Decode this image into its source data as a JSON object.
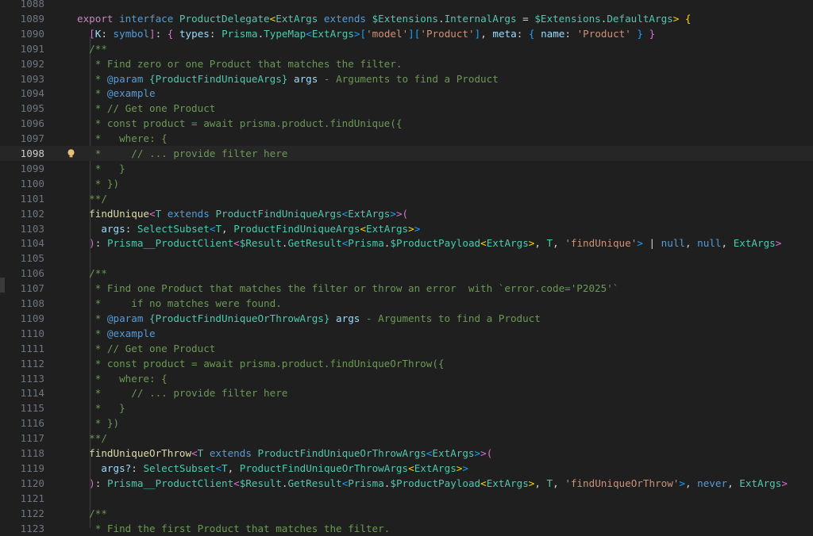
{
  "editor": {
    "current_line": 1098,
    "lines": [
      {
        "n": "1088",
        "tokens": []
      },
      {
        "n": "1089",
        "tokens": [
          [
            "kw2",
            "export "
          ],
          [
            "kw",
            "interface "
          ],
          [
            "ty",
            "ProductDelegate"
          ],
          [
            "br1",
            "<"
          ],
          [
            "ty",
            "ExtArgs "
          ],
          [
            "kw",
            "extends "
          ],
          [
            "ty",
            "$Extensions"
          ],
          [
            "pn",
            "."
          ],
          [
            "ty",
            "InternalArgs"
          ],
          [
            "pn",
            " = "
          ],
          [
            "ty",
            "$Extensions"
          ],
          [
            "pn",
            "."
          ],
          [
            "ty",
            "DefaultArgs"
          ],
          [
            "br1",
            "> "
          ],
          [
            "br1",
            "{"
          ]
        ]
      },
      {
        "n": "1090",
        "tokens": [
          [
            "pn",
            "  "
          ],
          [
            "br2",
            "["
          ],
          [
            "id",
            "K"
          ],
          [
            "pn",
            ": "
          ],
          [
            "kw",
            "symbol"
          ],
          [
            "br2",
            "]"
          ],
          [
            "pn",
            ": "
          ],
          [
            "br2",
            "{ "
          ],
          [
            "id",
            "types"
          ],
          [
            "pn",
            ": "
          ],
          [
            "ty",
            "Prisma"
          ],
          [
            "pn",
            "."
          ],
          [
            "ty",
            "TypeMap"
          ],
          [
            "br3",
            "<"
          ],
          [
            "ty",
            "ExtArgs"
          ],
          [
            "br3",
            ">"
          ],
          [
            "br3",
            "["
          ],
          [
            "str",
            "'model'"
          ],
          [
            "br3",
            "]"
          ],
          [
            "br3",
            "["
          ],
          [
            "str",
            "'Product'"
          ],
          [
            "br3",
            "]"
          ],
          [
            "pn",
            ", "
          ],
          [
            "id",
            "meta"
          ],
          [
            "pn",
            ": "
          ],
          [
            "br3",
            "{ "
          ],
          [
            "id",
            "name"
          ],
          [
            "pn",
            ": "
          ],
          [
            "str",
            "'Product'"
          ],
          [
            "br3",
            " }"
          ],
          [
            "br2",
            " }"
          ]
        ]
      },
      {
        "n": "1091",
        "tokens": [
          [
            "cm",
            "  /**"
          ]
        ]
      },
      {
        "n": "1092",
        "tokens": [
          [
            "cm",
            "   * Find zero or one Product that matches the filter."
          ]
        ]
      },
      {
        "n": "1093",
        "tokens": [
          [
            "cm",
            "   * "
          ],
          [
            "jd",
            "@param "
          ],
          [
            "jt",
            "{ProductFindUniqueArgs} "
          ],
          [
            "id",
            "args "
          ],
          [
            "cm",
            "- Arguments to find a Product"
          ]
        ]
      },
      {
        "n": "1094",
        "tokens": [
          [
            "cm",
            "   * "
          ],
          [
            "jd",
            "@example"
          ]
        ]
      },
      {
        "n": "1095",
        "tokens": [
          [
            "cm",
            "   * // Get one Product"
          ]
        ]
      },
      {
        "n": "1096",
        "tokens": [
          [
            "cm",
            "   * const product = await prisma.product.findUnique({"
          ]
        ]
      },
      {
        "n": "1097",
        "tokens": [
          [
            "cm",
            "   *   where: {"
          ]
        ]
      },
      {
        "n": "1098",
        "tokens": [
          [
            "cm",
            "   *     // ... provide filter here"
          ]
        ]
      },
      {
        "n": "1099",
        "tokens": [
          [
            "cm",
            "   *   }"
          ]
        ]
      },
      {
        "n": "1100",
        "tokens": [
          [
            "cm",
            "   * })"
          ]
        ]
      },
      {
        "n": "1101",
        "tokens": [
          [
            "cm",
            "  **/"
          ]
        ]
      },
      {
        "n": "1102",
        "tokens": [
          [
            "pn",
            "  "
          ],
          [
            "fn",
            "findUnique"
          ],
          [
            "br2",
            "<"
          ],
          [
            "ty",
            "T "
          ],
          [
            "kw",
            "extends "
          ],
          [
            "ty",
            "ProductFindUniqueArgs"
          ],
          [
            "br3",
            "<"
          ],
          [
            "ty",
            "ExtArgs"
          ],
          [
            "br3",
            ">"
          ],
          [
            "br2",
            ">"
          ],
          [
            "br2",
            "("
          ]
        ]
      },
      {
        "n": "1103",
        "tokens": [
          [
            "pn",
            "    "
          ],
          [
            "id",
            "args"
          ],
          [
            "pn",
            ": "
          ],
          [
            "ty",
            "SelectSubset"
          ],
          [
            "br3",
            "<"
          ],
          [
            "ty",
            "T"
          ],
          [
            "pn",
            ", "
          ],
          [
            "ty",
            "ProductFindUniqueArgs"
          ],
          [
            "br1",
            "<"
          ],
          [
            "ty",
            "ExtArgs"
          ],
          [
            "br1",
            ">"
          ],
          [
            "br3",
            ">"
          ]
        ]
      },
      {
        "n": "1104",
        "tokens": [
          [
            "pn",
            "  "
          ],
          [
            "br2",
            ")"
          ],
          [
            "pn",
            ": "
          ],
          [
            "ty",
            "Prisma__ProductClient"
          ],
          [
            "br2",
            "<"
          ],
          [
            "ty",
            "$Result"
          ],
          [
            "pn",
            "."
          ],
          [
            "ty",
            "GetResult"
          ],
          [
            "br3",
            "<"
          ],
          [
            "ty",
            "Prisma"
          ],
          [
            "pn",
            "."
          ],
          [
            "ty",
            "$ProductPayload"
          ],
          [
            "br1",
            "<"
          ],
          [
            "ty",
            "ExtArgs"
          ],
          [
            "br1",
            ">"
          ],
          [
            "pn",
            ", "
          ],
          [
            "ty",
            "T"
          ],
          [
            "pn",
            ", "
          ],
          [
            "str",
            "'findUnique'"
          ],
          [
            "br3",
            ">"
          ],
          [
            "pn",
            " | "
          ],
          [
            "kw",
            "null"
          ],
          [
            "pn",
            ", "
          ],
          [
            "kw",
            "null"
          ],
          [
            "pn",
            ", "
          ],
          [
            "ty",
            "ExtArgs"
          ],
          [
            "br2",
            ">"
          ]
        ]
      },
      {
        "n": "1105",
        "tokens": []
      },
      {
        "n": "1106",
        "tokens": [
          [
            "cm",
            "  /**"
          ]
        ]
      },
      {
        "n": "1107",
        "tokens": [
          [
            "cm",
            "   * Find one Product that matches the filter or throw an error  with `error.code='P2025'`"
          ]
        ]
      },
      {
        "n": "1108",
        "tokens": [
          [
            "cm",
            "   *     if no matches were found."
          ]
        ]
      },
      {
        "n": "1109",
        "tokens": [
          [
            "cm",
            "   * "
          ],
          [
            "jd",
            "@param "
          ],
          [
            "jt",
            "{ProductFindUniqueOrThrowArgs} "
          ],
          [
            "id",
            "args "
          ],
          [
            "cm",
            "- Arguments to find a Product"
          ]
        ]
      },
      {
        "n": "1110",
        "tokens": [
          [
            "cm",
            "   * "
          ],
          [
            "jd",
            "@example"
          ]
        ]
      },
      {
        "n": "1111",
        "tokens": [
          [
            "cm",
            "   * // Get one Product"
          ]
        ]
      },
      {
        "n": "1112",
        "tokens": [
          [
            "cm",
            "   * const product = await prisma.product.findUniqueOrThrow({"
          ]
        ]
      },
      {
        "n": "1113",
        "tokens": [
          [
            "cm",
            "   *   where: {"
          ]
        ]
      },
      {
        "n": "1114",
        "tokens": [
          [
            "cm",
            "   *     // ... provide filter here"
          ]
        ]
      },
      {
        "n": "1115",
        "tokens": [
          [
            "cm",
            "   *   }"
          ]
        ]
      },
      {
        "n": "1116",
        "tokens": [
          [
            "cm",
            "   * })"
          ]
        ]
      },
      {
        "n": "1117",
        "tokens": [
          [
            "cm",
            "  **/"
          ]
        ]
      },
      {
        "n": "1118",
        "tokens": [
          [
            "pn",
            "  "
          ],
          [
            "fn",
            "findUniqueOrThrow"
          ],
          [
            "br2",
            "<"
          ],
          [
            "ty",
            "T "
          ],
          [
            "kw",
            "extends "
          ],
          [
            "ty",
            "ProductFindUniqueOrThrowArgs"
          ],
          [
            "br3",
            "<"
          ],
          [
            "ty",
            "ExtArgs"
          ],
          [
            "br3",
            ">"
          ],
          [
            "br2",
            ">"
          ],
          [
            "br2",
            "("
          ]
        ]
      },
      {
        "n": "1119",
        "tokens": [
          [
            "pn",
            "    "
          ],
          [
            "id",
            "args?"
          ],
          [
            "pn",
            ": "
          ],
          [
            "ty",
            "SelectSubset"
          ],
          [
            "br3",
            "<"
          ],
          [
            "ty",
            "T"
          ],
          [
            "pn",
            ", "
          ],
          [
            "ty",
            "ProductFindUniqueOrThrowArgs"
          ],
          [
            "br1",
            "<"
          ],
          [
            "ty",
            "ExtArgs"
          ],
          [
            "br1",
            ">"
          ],
          [
            "br3",
            ">"
          ]
        ]
      },
      {
        "n": "1120",
        "tokens": [
          [
            "pn",
            "  "
          ],
          [
            "br2",
            ")"
          ],
          [
            "pn",
            ": "
          ],
          [
            "ty",
            "Prisma__ProductClient"
          ],
          [
            "br2",
            "<"
          ],
          [
            "ty",
            "$Result"
          ],
          [
            "pn",
            "."
          ],
          [
            "ty",
            "GetResult"
          ],
          [
            "br3",
            "<"
          ],
          [
            "ty",
            "Prisma"
          ],
          [
            "pn",
            "."
          ],
          [
            "ty",
            "$ProductPayload"
          ],
          [
            "br1",
            "<"
          ],
          [
            "ty",
            "ExtArgs"
          ],
          [
            "br1",
            ">"
          ],
          [
            "pn",
            ", "
          ],
          [
            "ty",
            "T"
          ],
          [
            "pn",
            ", "
          ],
          [
            "str",
            "'findUniqueOrThrow'"
          ],
          [
            "br3",
            ">"
          ],
          [
            "pn",
            ", "
          ],
          [
            "kw",
            "never"
          ],
          [
            "pn",
            ", "
          ],
          [
            "ty",
            "ExtArgs"
          ],
          [
            "br2",
            ">"
          ]
        ]
      },
      {
        "n": "1121",
        "tokens": []
      },
      {
        "n": "1122",
        "tokens": [
          [
            "cm",
            "  /**"
          ]
        ]
      },
      {
        "n": "1123",
        "tokens": [
          [
            "cm",
            "   * Find the first Product that matches the filter."
          ]
        ]
      }
    ]
  },
  "icons": {
    "lightbulb": "lightbulb-icon"
  }
}
